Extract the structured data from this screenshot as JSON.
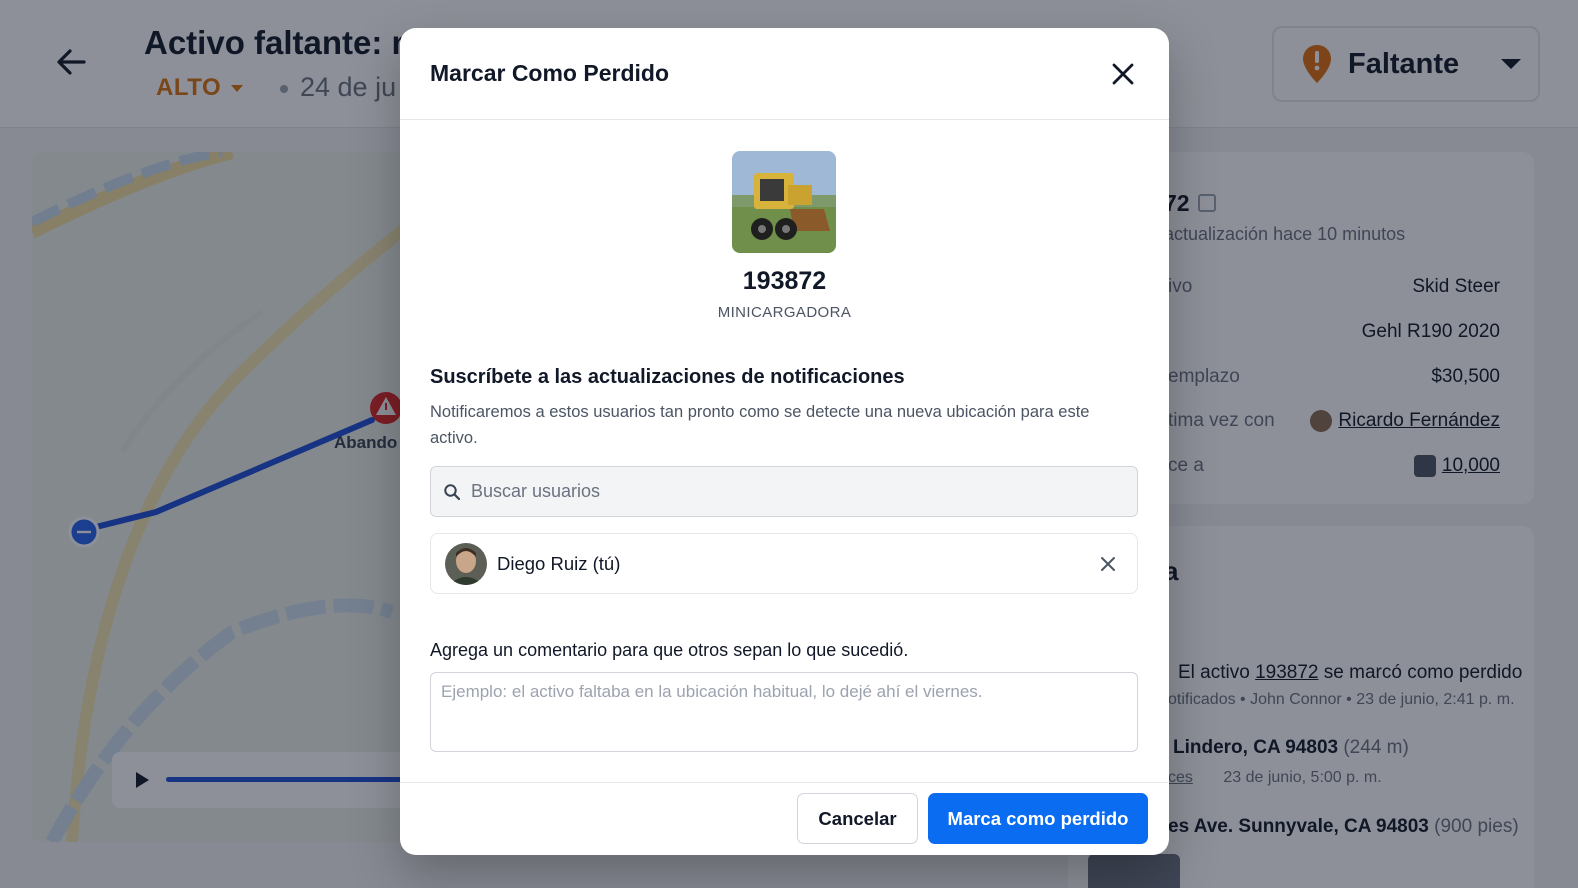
{
  "page": {
    "title": "Activo faltante: m",
    "severity": "ALTO",
    "date": "24 de ju",
    "status": "Faltante",
    "map_label": "Abando"
  },
  "details": {
    "asset_id": "72",
    "updated": "actualización hace 10 minutos",
    "rows": [
      {
        "label": "ivo",
        "value": "Skid Steer"
      },
      {
        "label": "",
        "value": "Gehl R190 2020"
      },
      {
        "label": "emplazo",
        "value": "$30,500"
      },
      {
        "label": "tima vez con",
        "value": "Ricardo Fernández"
      },
      {
        "label": "ce a",
        "value": "10,000"
      }
    ]
  },
  "history": {
    "heading": "a",
    "event1_pre": "El activo",
    "event1_link": "193872",
    "event1_post": "se marcó como perdido",
    "event1_meta": "otificados  •  John Connor  •  23 de junio, 2:41 p. m.",
    "event2_title": "Lindero, CA 94803",
    "event2_dist": "(244 m)",
    "event2_meta_link": "ces",
    "event2_meta": "23 de junio, 5:00 p. m.",
    "event3_title": "es Ave. Sunnyvale, CA 94803",
    "event3_dist": "(900 pies)"
  },
  "modal": {
    "title": "Marcar Como Perdido",
    "asset_id": "193872",
    "asset_type": "MINICARGADORA",
    "subscribe_title": "Suscríbete a las actualizaciones de notificaciones",
    "subscribe_desc": "Notificaremos a estos usuarios tan pronto como se detecte una nueva ubicación para este activo.",
    "search_placeholder": "Buscar usuarios",
    "user_name": "Diego Ruiz (tú)",
    "comment_label": "Agrega un comentario para que otros sepan lo que sucedió.",
    "comment_placeholder": "Ejemplo: el activo faltaba en la ubicación habitual, lo dejé ahí el viernes.",
    "cancel_label": "Cancelar",
    "confirm_label": "Marca como perdido"
  },
  "colors": {
    "primary": "#0a6cf0",
    "severity": "#d9730d",
    "status_pin": "#e06c0c",
    "route": "#1d4ed8"
  }
}
